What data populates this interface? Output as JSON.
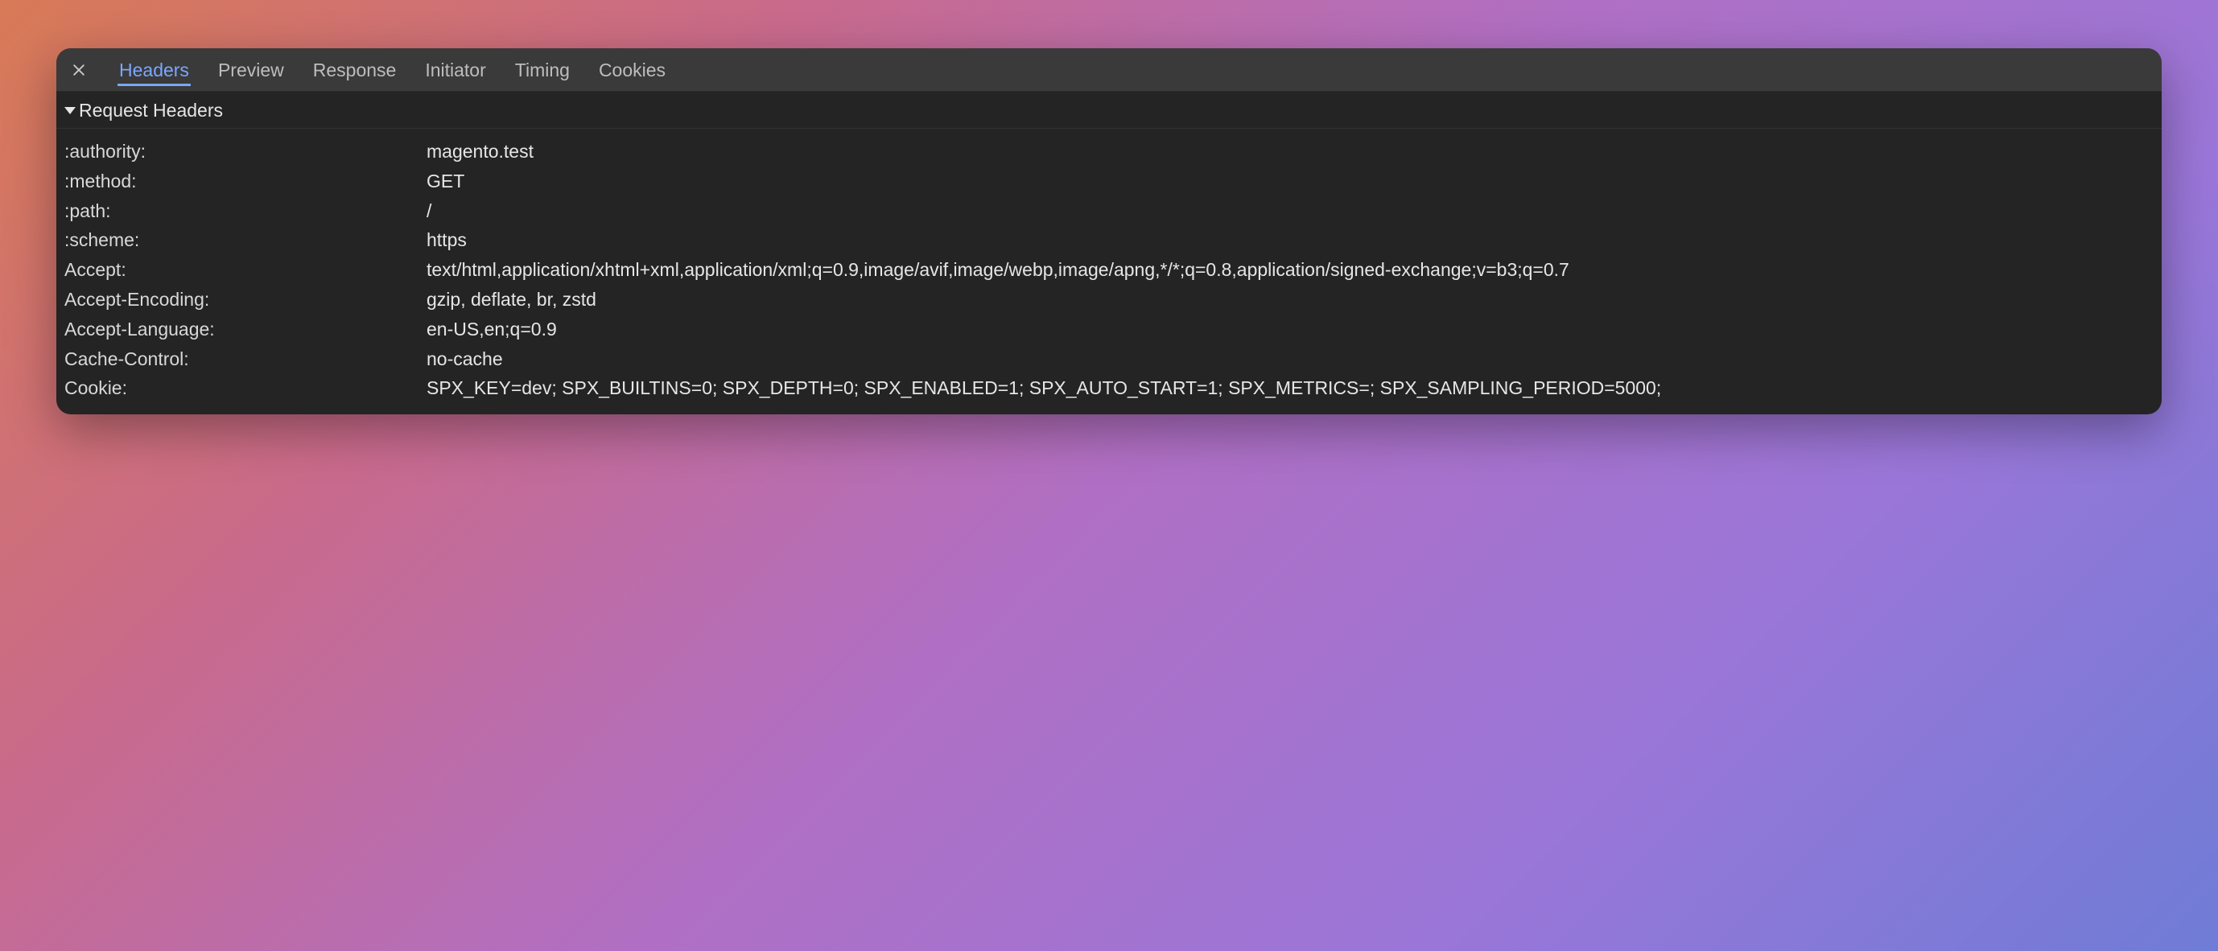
{
  "tabs": {
    "headers": "Headers",
    "preview": "Preview",
    "response": "Response",
    "initiator": "Initiator",
    "timing": "Timing",
    "cookies": "Cookies"
  },
  "section": {
    "title": "Request Headers"
  },
  "headers": {
    "authority": {
      "k": ":authority:",
      "v": "magento.test"
    },
    "method": {
      "k": ":method:",
      "v": "GET"
    },
    "path": {
      "k": ":path:",
      "v": "/"
    },
    "scheme": {
      "k": ":scheme:",
      "v": "https"
    },
    "accept": {
      "k": "Accept:",
      "v": "text/html,application/xhtml+xml,application/xml;q=0.9,image/avif,image/webp,image/apng,*/*;q=0.8,application/signed-exchange;v=b3;q=0.7"
    },
    "accept_encoding": {
      "k": "Accept-Encoding:",
      "v": "gzip, deflate, br, zstd"
    },
    "accept_language": {
      "k": "Accept-Language:",
      "v": "en-US,en;q=0.9"
    },
    "cache_control": {
      "k": "Cache-Control:",
      "v": "no-cache"
    },
    "cookie": {
      "k": "Cookie:",
      "v": "SPX_KEY=dev; SPX_BUILTINS=0; SPX_DEPTH=0; SPX_ENABLED=1; SPX_AUTO_START=1; SPX_METRICS=; SPX_SAMPLING_PERIOD=5000;"
    }
  }
}
